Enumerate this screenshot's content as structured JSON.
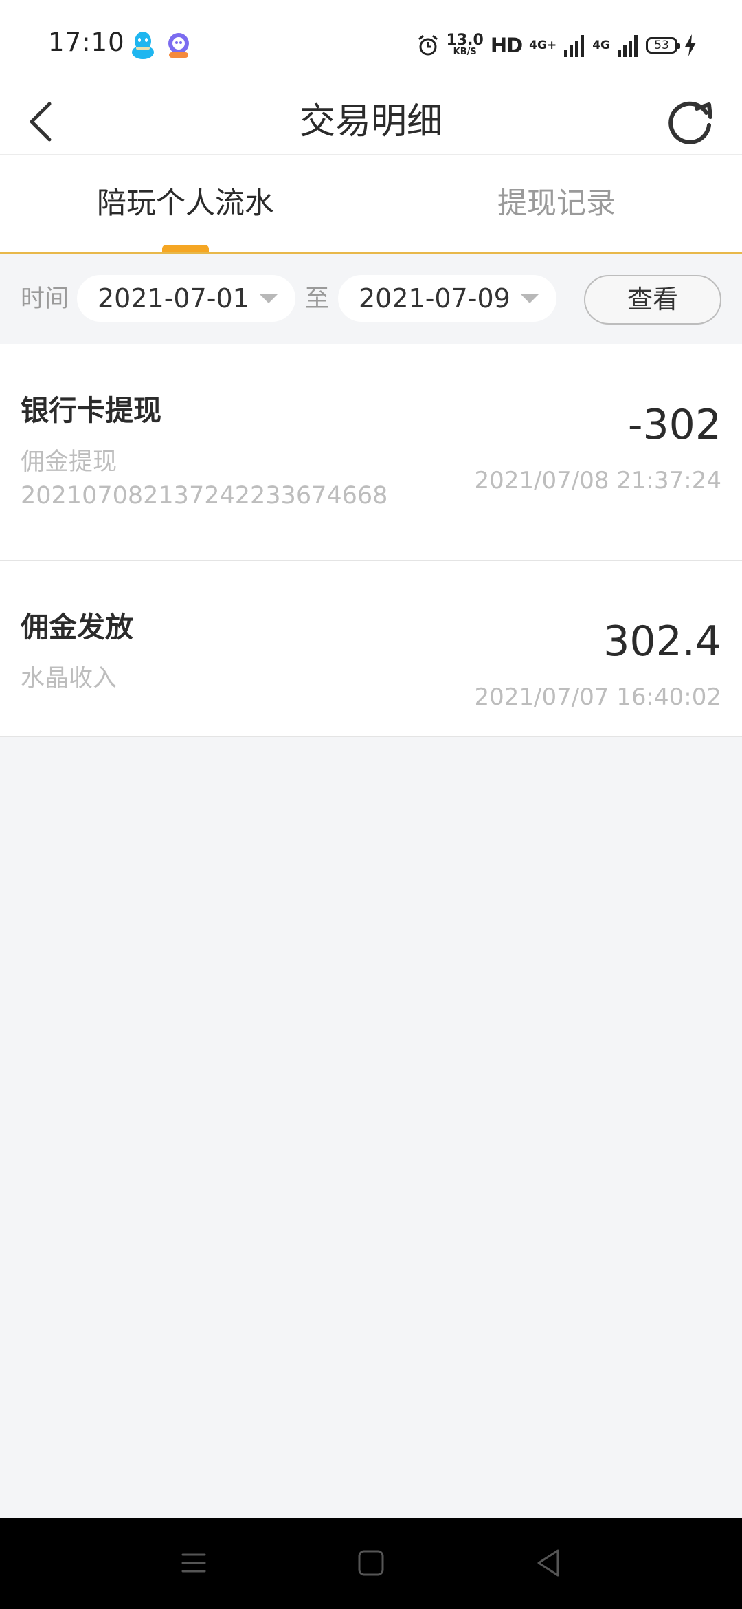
{
  "status_bar": {
    "time": "17:10",
    "net_speed_value": "13.0",
    "net_speed_unit": "KB/S",
    "hd_label": "HD",
    "signal_1_label": "4G+",
    "signal_2_label": "4G",
    "battery_level": "53",
    "icons": [
      "qq-icon",
      "app-icon",
      "alarm-icon",
      "signal-icon",
      "charging-icon"
    ]
  },
  "nav": {
    "title": "交易明细"
  },
  "tabs": [
    {
      "label": "陪玩个人流水",
      "active": true
    },
    {
      "label": "提现记录",
      "active": false
    }
  ],
  "filter": {
    "time_label": "时间",
    "start_date": "2021-07-01",
    "to_label": "至",
    "end_date": "2021-07-09",
    "view_label": "查看"
  },
  "transactions": [
    {
      "title": "银行卡提现",
      "category": "佣金提现",
      "order_no": "20210708213724223367466​8",
      "amount": "-302",
      "time": "2021/07/08 21:37:24"
    },
    {
      "title": "佣金发放",
      "category": "水晶收入",
      "amount": "302.4",
      "time": "2021/07/07 16:40:02"
    }
  ],
  "colors": {
    "accent": "#f5a623",
    "tab_underline": "#e8b84a",
    "background": "#f4f5f7"
  }
}
